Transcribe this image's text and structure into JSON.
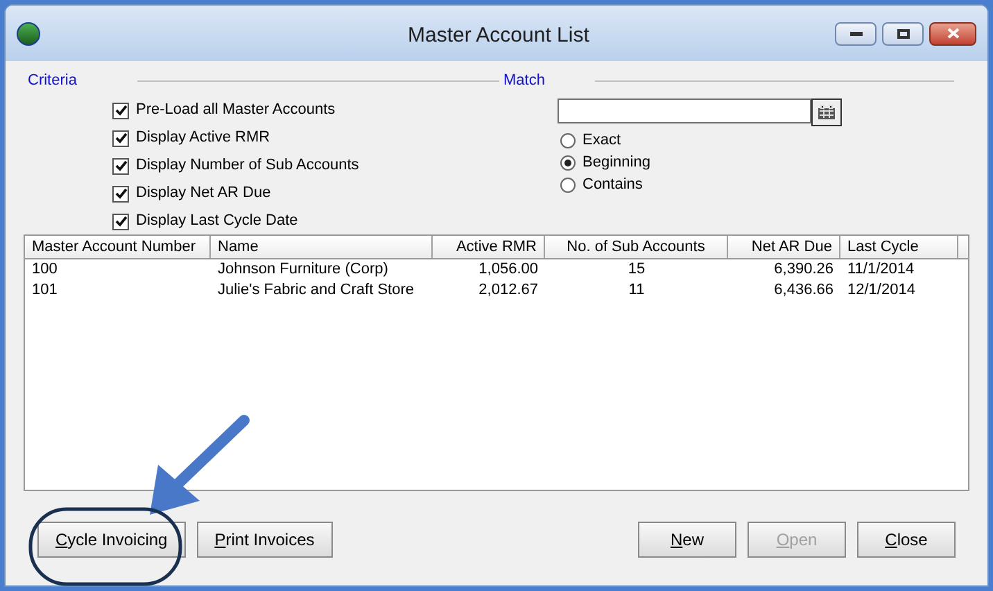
{
  "window": {
    "title": "Master Account List"
  },
  "criteria": {
    "title": "Criteria",
    "options": [
      {
        "label": "Pre-Load all Master Accounts",
        "checked": true
      },
      {
        "label": "Display Active RMR",
        "checked": true
      },
      {
        "label": "Display Number of Sub Accounts",
        "checked": true
      },
      {
        "label": "Display Net AR Due",
        "checked": true
      },
      {
        "label": "Display Last Cycle Date",
        "checked": true
      }
    ]
  },
  "match": {
    "title": "Match",
    "modes": [
      {
        "label": "Exact",
        "selected": false
      },
      {
        "label": "Beginning",
        "selected": true
      },
      {
        "label": "Contains",
        "selected": false
      }
    ]
  },
  "table": {
    "columns": [
      "Master Account Number",
      "Name",
      "Active RMR",
      "No. of Sub Accounts",
      "Net AR Due",
      "Last Cycle"
    ],
    "rows": [
      [
        "100",
        "Johnson Furniture (Corp)",
        "1,056.00",
        "15",
        "6,390.26",
        "11/1/2014"
      ],
      [
        "101",
        "Julie's Fabric and Craft Store",
        "2,012.67",
        "11",
        "6,436.66",
        "12/1/2014"
      ]
    ]
  },
  "left_buttons": [
    {
      "label": "Cycle Invoicing",
      "disabled": false
    },
    {
      "label": "Print Invoices",
      "disabled": false
    }
  ],
  "right_buttons": [
    {
      "label": "New",
      "disabled": false
    },
    {
      "label": "Open",
      "disabled": true
    },
    {
      "label": "Close",
      "disabled": false
    }
  ]
}
